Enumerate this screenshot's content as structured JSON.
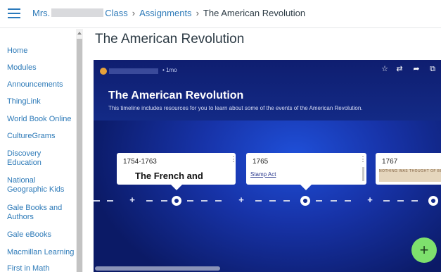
{
  "header": {
    "breadcrumb": {
      "course_prefix": "Mrs.",
      "course_suffix": "Class",
      "section": "Assignments",
      "current": "The American Revolution",
      "separator": "›"
    }
  },
  "sidebar": {
    "items": [
      {
        "label": "Home"
      },
      {
        "label": "Modules"
      },
      {
        "label": "Announcements"
      },
      {
        "label": "ThingLink"
      },
      {
        "label": "World Book Online"
      },
      {
        "label": "CultureGrams"
      },
      {
        "label": "Discovery Education"
      },
      {
        "label": "National Geographic Kids"
      },
      {
        "label": "Gale Books and Authors"
      },
      {
        "label": "Gale eBooks"
      },
      {
        "label": "Macmillan Learning"
      },
      {
        "label": "First in Math"
      }
    ]
  },
  "page": {
    "title": "The American Revolution"
  },
  "embed": {
    "posted_time": "• 1mo",
    "title": "The American Revolution",
    "description": "This timeline includes resources for you to learn about some of the events of the American Revolution.",
    "icons": [
      "star-icon",
      "repost-icon",
      "share-icon",
      "open-external-icon"
    ],
    "cards": [
      {
        "date": "1754-1763",
        "heading": "The French and"
      },
      {
        "date": "1765",
        "link": "Stamp Act"
      },
      {
        "date": "1767",
        "image_text": "NOTHING WAS THOUGHT OF BUT AND THE EASIEST METHOD"
      }
    ],
    "add_label": "+"
  },
  "colors": {
    "link": "#2d7ab8",
    "embed_background": "#1733a8",
    "fab": "#7ee06d"
  }
}
